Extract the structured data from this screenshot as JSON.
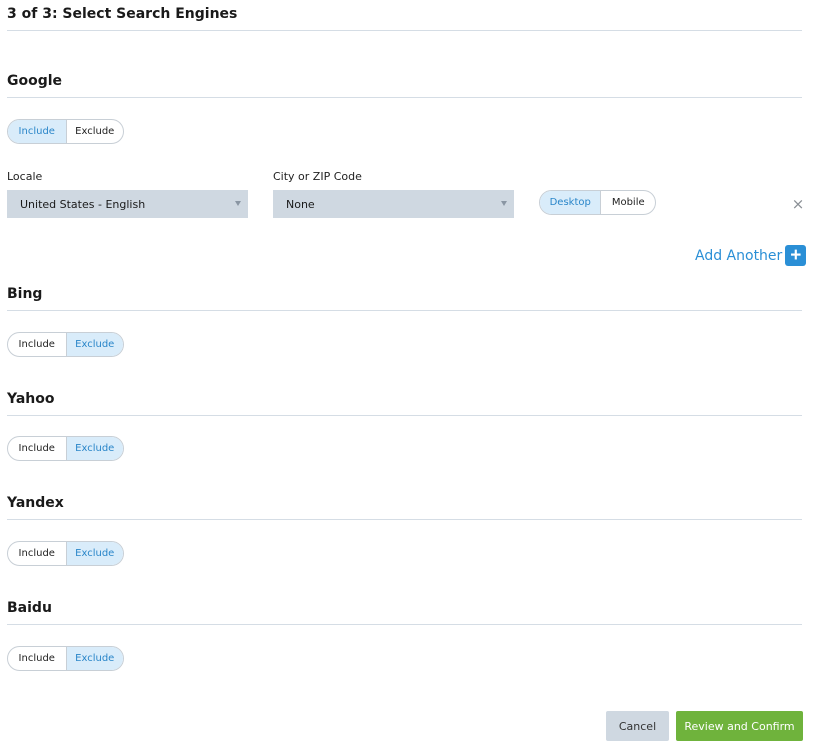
{
  "page": {
    "title": "3 of 3: Select Search Engines"
  },
  "google": {
    "title": "Google",
    "include_label": "Include",
    "exclude_label": "Exclude",
    "selected": "Include",
    "locale": {
      "label": "Locale",
      "value": "United States - English"
    },
    "city": {
      "label": "City or ZIP Code",
      "value": "None"
    },
    "device": {
      "desktop_label": "Desktop",
      "mobile_label": "Mobile",
      "selected": "Desktop"
    },
    "remove_icon": "×",
    "add_another_label": "Add Another",
    "add_icon": "+"
  },
  "engines": [
    {
      "title": "Bing",
      "include_label": "Include",
      "exclude_label": "Exclude",
      "selected": "Exclude"
    },
    {
      "title": "Yahoo",
      "include_label": "Include",
      "exclude_label": "Exclude",
      "selected": "Exclude"
    },
    {
      "title": "Yandex",
      "include_label": "Include",
      "exclude_label": "Exclude",
      "selected": "Exclude"
    },
    {
      "title": "Baidu",
      "include_label": "Include",
      "exclude_label": "Exclude",
      "selected": "Exclude"
    }
  ],
  "footer": {
    "cancel_label": "Cancel",
    "confirm_label": "Review and Confirm"
  },
  "colors": {
    "accent": "#2a8fd6",
    "toggle_active_bg": "#d9ecfa",
    "select_bg": "#cfd8e1",
    "confirm_bg": "#6fb33c"
  }
}
